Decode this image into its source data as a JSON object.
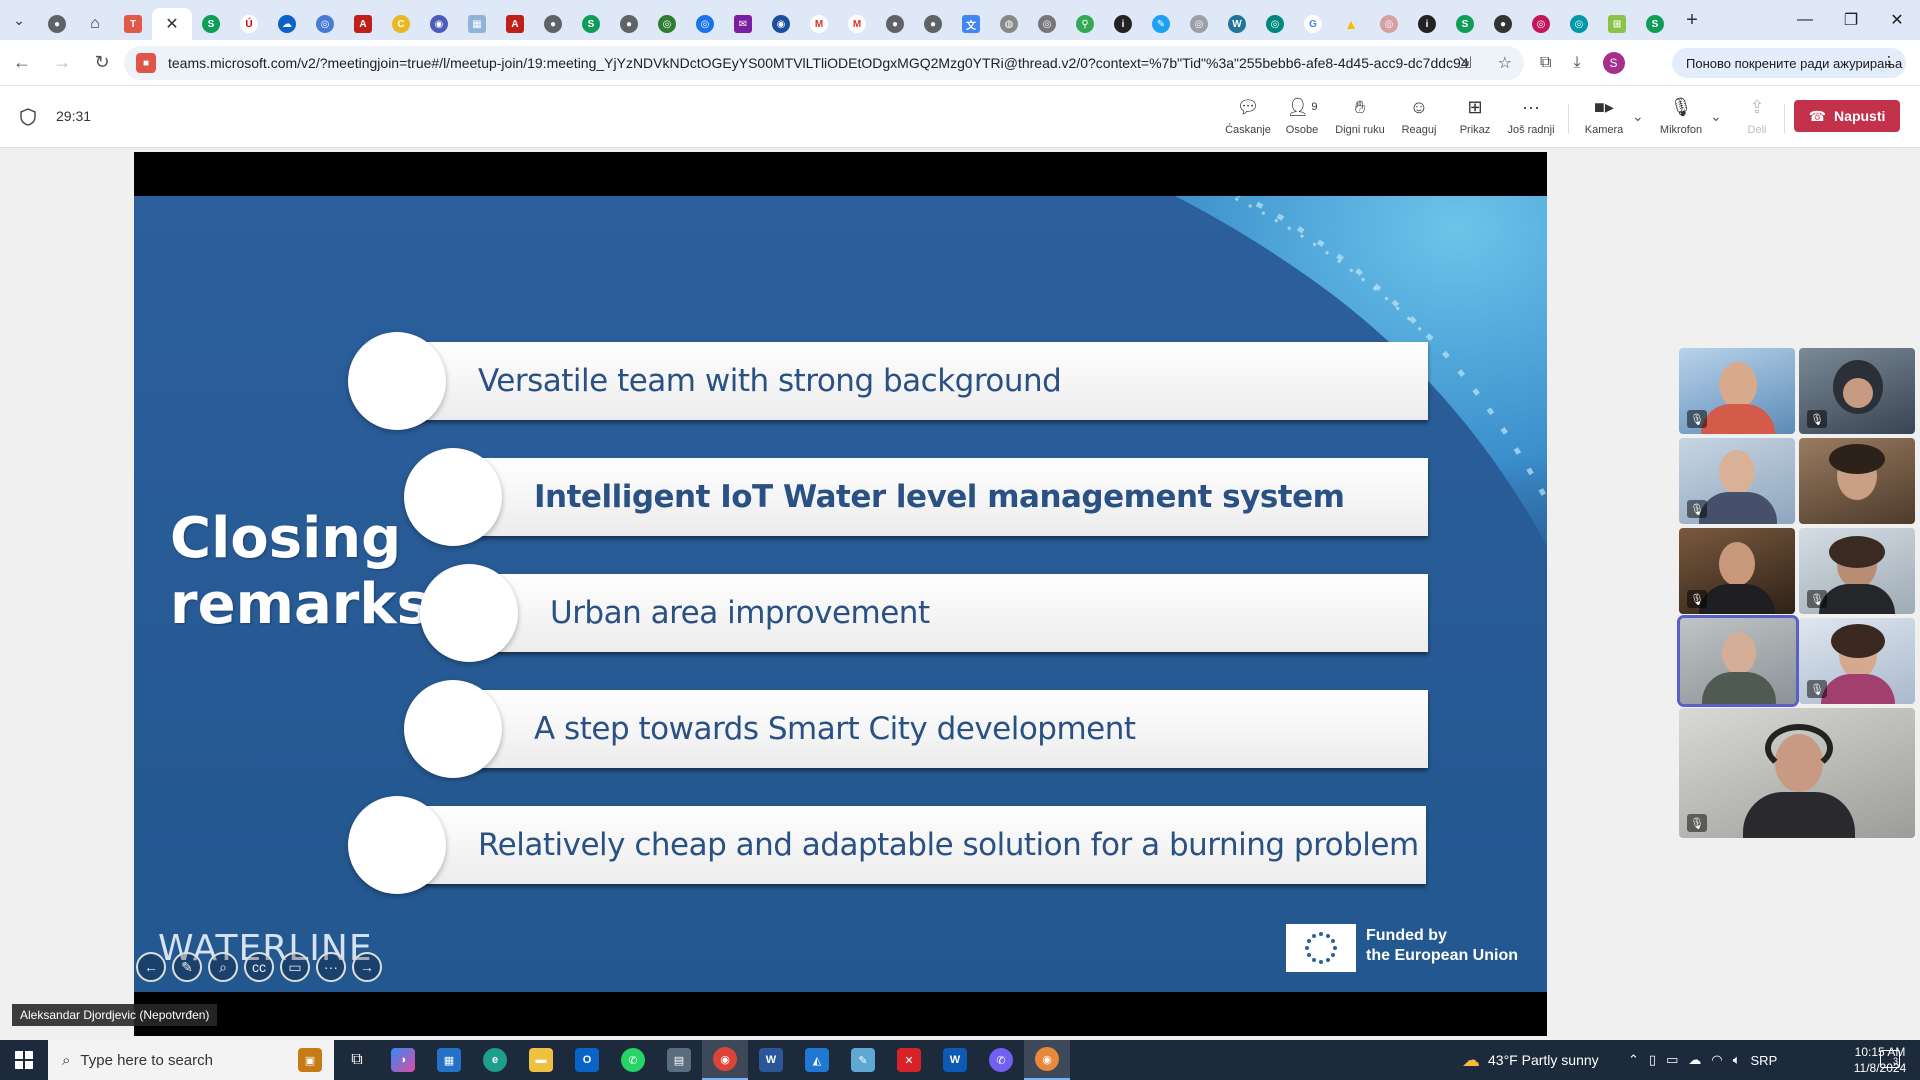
{
  "browser": {
    "tab_icons": [
      "chrome-icon",
      "home-icon",
      "teams-icon",
      "skype-icon",
      "app-icon",
      "onedrive-icon",
      "globe-icon",
      "pdf-icon",
      "circle-icon",
      "globe-icon",
      "image-icon",
      "pdf-icon",
      "chrome-icon",
      "skype-icon",
      "chrome-icon",
      "globe-icon",
      "globe-icon",
      "mail-icon",
      "globe-icon",
      "gmail-icon",
      "gmail-icon",
      "chrome-icon",
      "chrome-icon",
      "translate-icon",
      "chrome-icon",
      "chrome-icon",
      "maps-icon",
      "info-icon",
      "edit-icon",
      "globe-icon",
      "wordpress-icon",
      "globe-icon",
      "google-icon",
      "drive-icon",
      "globe-icon",
      "info-icon",
      "skype-icon",
      "chrome-icon",
      "globe-icon",
      "globe-icon",
      "sheets-icon",
      "skype-icon"
    ],
    "url": "teams.microsoft.com/v2/?meetingjoin=true#/l/meetup-join/19:meeting_YjYzNDVkNDctOGEyYS00MTVlLTliODEtODgxMGQ2Mzg0YTRi@thread.v2/0?context=%7b\"Tid\"%3a\"255bebb6-afe8-4d45-acc9-dc7ddc94...",
    "profile_initial": "S",
    "update_label": "Поново покрените ради ажурирања"
  },
  "meeting": {
    "timer": "29:31",
    "tools": {
      "chat": "Ćaskanje",
      "people": "Osobe",
      "people_count": "9",
      "raise": "Digni ruku",
      "react": "Reaguj",
      "view": "Prikaz",
      "more": "Još radnji",
      "camera": "Kamera",
      "mic": "Mikrofon",
      "share": "Deli"
    },
    "leave": "Napusti",
    "presenter": "Aleksandar Djordjevic (Nepotvrđen)"
  },
  "slide": {
    "title_line1": "Closing",
    "title_line2": "remarks:",
    "items": [
      "Versatile team with strong background",
      "Intelligent IoT Water level management system",
      "Urban area improvement",
      "A step towards Smart City development",
      "Relatively cheap and adaptable solution for a burning problem"
    ],
    "logo": "WATERLINE",
    "funded_line1": "Funded by",
    "funded_line2": "the European Union"
  },
  "taskbar": {
    "search_placeholder": "Type here to search",
    "weather": "43°F  Partly sunny",
    "lang": "SRP",
    "time": "10:15 AM",
    "date": "11/8/2024",
    "notifications": "3"
  },
  "colors": {
    "slide_bg": "#2c5f9c",
    "item_text": "#2a5184",
    "leave_red": "#c4314b",
    "taskbar": "#1c2a3c"
  }
}
